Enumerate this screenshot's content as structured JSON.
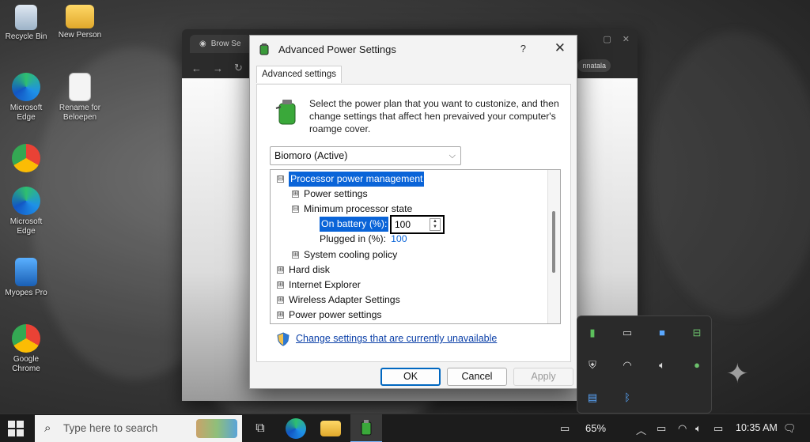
{
  "desktop": {
    "icons": [
      {
        "label": "Recycle Bin"
      },
      {
        "label": "New Person"
      },
      {
        "label": "Microsoft Edge"
      },
      {
        "label": "Rename for Beloepen"
      },
      {
        "label": "Microsoft Edge"
      },
      {
        "label": "Myopes Pro"
      },
      {
        "label": "Google Chrome"
      }
    ]
  },
  "browser": {
    "tab_title": "Brow Se",
    "account_label": "nnatala"
  },
  "dialog": {
    "title": "Advanced Power Settings",
    "help_label": "?",
    "close_label": "✕",
    "tab_label": "Advanced settings",
    "intro": "Select the power plan that you want to custonize, and then change settings that affect hen prevaived your computer's roamge cover.",
    "plan_selected": "Biomoro (Active)",
    "tree": {
      "items": [
        {
          "label": "Processor power management",
          "expander": "⊟"
        },
        {
          "label": "Power settings",
          "expander": "⊞"
        },
        {
          "label": "Minimum processor state",
          "expander": "⊟"
        },
        {
          "label": "On battery (%):"
        },
        {
          "label": "Plugged in (%):",
          "value": "100"
        },
        {
          "label": "System cooling policy",
          "expander": "⊞"
        },
        {
          "label": "Hard disk",
          "expander": "⊞"
        },
        {
          "label": "Internet Explorer",
          "expander": "⊞"
        },
        {
          "label": "Wireless Adapter Settings",
          "expander": "⊞"
        },
        {
          "label": "Power power settings",
          "expander": "⊞"
        }
      ],
      "on_battery_value": "100"
    },
    "change_link": "Change settings that are currently unavailable",
    "buttons": {
      "ok": "OK",
      "cancel": "Cancel",
      "apply": "Apply"
    }
  },
  "taskbar": {
    "search_placeholder": "Type here to search",
    "battery_percent": "65%",
    "time": "10:35 AM"
  },
  "colors": {
    "selection": "#0a64d8",
    "link": "#0a3fa8",
    "taskbar": "#1c1c1c"
  }
}
